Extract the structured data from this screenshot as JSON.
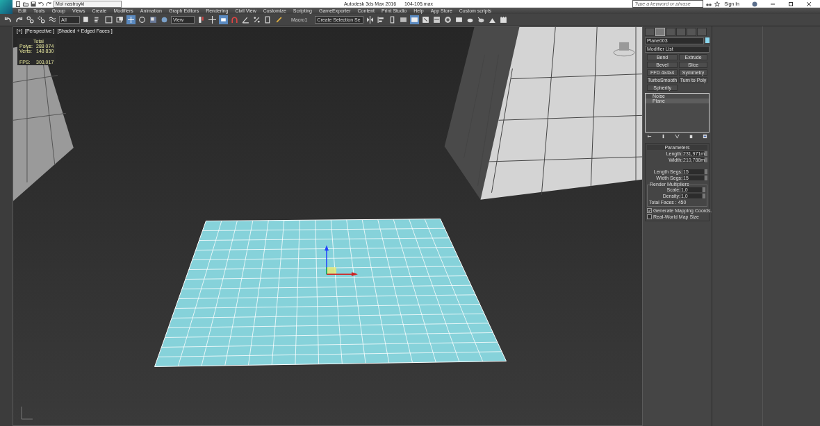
{
  "quick_access": {
    "workspace": "Moi nastroyki"
  },
  "window": {
    "title": "Autodesk 3ds Max 2016",
    "file": "104-105.max"
  },
  "search": {
    "placeholder": "Type a keyword or phrase"
  },
  "sign_in": "Sign In",
  "menu": [
    "Edit",
    "Tools",
    "Group",
    "Views",
    "Create",
    "Modifiers",
    "Animation",
    "Graph Editors",
    "Rendering",
    "Civil View",
    "Customize",
    "Scripting",
    "GameExporter",
    "Content",
    "Print Studio",
    "Help",
    "App Store",
    "Custom scripts"
  ],
  "toolbar": {
    "selection_filter": "All",
    "reference_coord": "View",
    "macro": "Macro1",
    "selection_set": "Create Selection Se"
  },
  "viewport": {
    "labels": [
      "[+]",
      "[Perspective ]",
      "[Shaded + Edged Faces ]"
    ],
    "stats_header": "Total",
    "stats": [
      {
        "label": "Polys:",
        "value": "288 074"
      },
      {
        "label": "Verts:",
        "value": "148 830"
      },
      {
        "label": "FPS:",
        "value": "303,017"
      }
    ]
  },
  "command_panel": {
    "tabs": [
      {
        "selected": false
      },
      {
        "selected": true
      },
      {
        "selected": false
      },
      {
        "selected": false
      },
      {
        "selected": false
      },
      {
        "selected": false
      }
    ],
    "object_name": "Plane003",
    "modifier_list": "Modifier List",
    "modifier_buttons": [
      "Bend",
      "Extrude",
      "Bevel",
      "Slice",
      "FFD 4x4x4",
      "Symmetry",
      "TurboSmooth",
      "Turn to Poly",
      "Spherify"
    ],
    "stack": [
      {
        "label": "Noise",
        "selected": false
      },
      {
        "label": "Plane",
        "selected": true
      }
    ],
    "parameters": {
      "title": "Parameters",
      "fields": [
        {
          "label": "Length:",
          "value": "231,971m"
        },
        {
          "label": "Width:",
          "value": "210,788m"
        },
        {
          "label": "Length Segs:",
          "value": "15"
        },
        {
          "label": "Width Segs:",
          "value": "15"
        }
      ],
      "render_multipliers": {
        "title": "Render Multipliers",
        "fields": [
          {
            "label": "Scale:",
            "value": "1,0"
          },
          {
            "label": "Density:",
            "value": "1,0"
          }
        ],
        "total_faces": "Total Faces : 450"
      },
      "checkboxes": [
        {
          "label": "Generate Mapping Coords.",
          "checked": true
        },
        {
          "label": "Real-World Map Size",
          "checked": false
        }
      ]
    }
  }
}
